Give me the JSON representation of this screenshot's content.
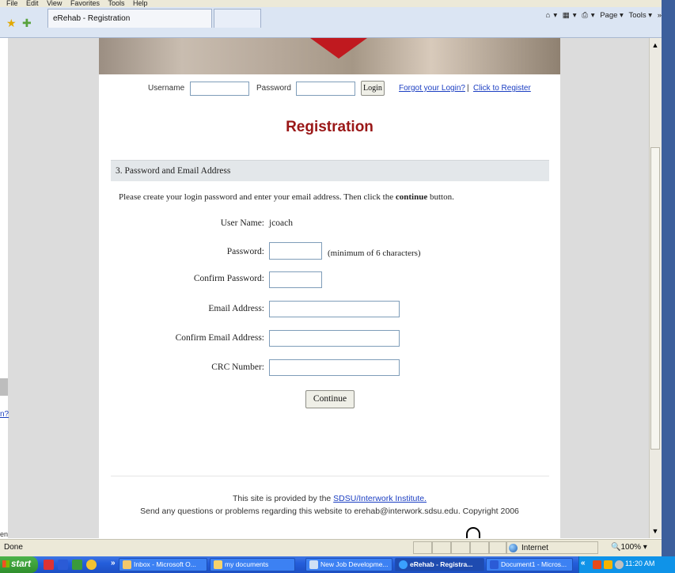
{
  "browser": {
    "menubar": [
      "File",
      "Edit",
      "View",
      "Favorites",
      "Tools",
      "Help"
    ],
    "tab_title": "eRehab - Registration",
    "commands": {
      "home": "▾",
      "feeds": "▾",
      "print": "▾",
      "page": "Page ▾",
      "tools": "Tools ▾",
      "more": "»"
    },
    "status_text": "Done",
    "zone": "Internet",
    "zoom": "100%"
  },
  "login": {
    "username_label": "Username",
    "password_label": "Password",
    "login_button": "Login",
    "forgot_link": "Forgot your Login?",
    "separator": "|",
    "register_link": "Click to Register"
  },
  "page": {
    "title": "Registration",
    "section": "3. Password and Email Address",
    "instructions_pre": "Please create your login password and enter your email address. Then click the",
    "instructions_bold": "continue",
    "instructions_post": "button.",
    "fields": {
      "username_label": "User Name:",
      "username_value": "jcoach",
      "password_label": "Password:",
      "password_hint": "(minimum of 6 characters)",
      "confirm_password_label": "Confirm Password:",
      "email_label": "Email Address:",
      "confirm_email_label": "Confirm Email Address:",
      "crc_label": "CRC Number:"
    },
    "continue_button": "Continue",
    "footer_pre": "This site is provided by the",
    "footer_link": "SDSU/Interwork Institute.",
    "footer2": "Send any questions or problems regarding this website to erehab@interwork.sdsu.edu. Copyright 2006"
  },
  "background_fragments": {
    "left_link": "n?",
    "left_bottom": "en"
  },
  "taskbar": {
    "start": "start",
    "buttons": [
      "Inbox - Microsoft O...",
      "my documents",
      "New Job Developme...",
      "eRehab - Registra...",
      "Document1 - Micros..."
    ],
    "overflow": "»",
    "tray_overflow": "«",
    "time": "11:20 AM"
  }
}
